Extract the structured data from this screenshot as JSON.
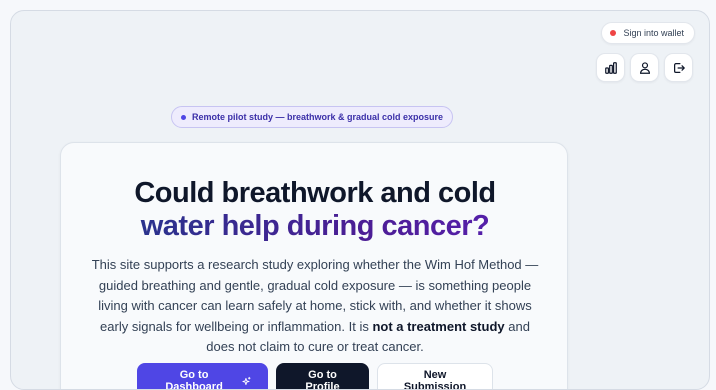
{
  "wallet": {
    "label": "Sign into wallet",
    "status_color": "#ef4444"
  },
  "header_icons": [
    {
      "name": "stats-icon",
      "title": "Stats"
    },
    {
      "name": "user-icon",
      "title": "Profile"
    },
    {
      "name": "logout-icon",
      "title": "Log out"
    }
  ],
  "badge": {
    "text": "Remote pilot study — breathwork & gradual cold exposure"
  },
  "hero": {
    "headline_line1": "Could breathwork and cold",
    "headline_line2": "water help during cancer?",
    "description_intro": "This site supports a research study exploring whether the Wim Hof Method — guided breathing and gentle, gradual cold exposure — is something people living with cancer can learn safely at home, stick with, and whether it shows early signals for wellbeing or inflammation. It is ",
    "description_emphasis": "not a treatment study",
    "description_outro": " and does not claim to cure or treat cancer."
  },
  "actions": {
    "dashboard_label": "Go to Dashboard",
    "profile_label": "Go to Profile",
    "submission_label": "New Submission"
  },
  "colors": {
    "accent": "#4f46e5",
    "dark": "#0f172a",
    "badge_bg": "#eeecfd",
    "badge_text": "#3b2fa8"
  }
}
